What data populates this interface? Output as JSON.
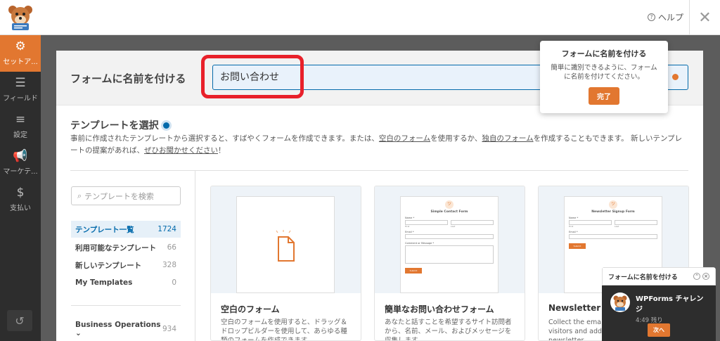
{
  "topbar": {
    "help_label": "ヘルプ",
    "help_icon": "question-circle-icon",
    "close_icon": "close-icon"
  },
  "sidebar": {
    "items": [
      {
        "label": "セットア...",
        "icon": "gear-icon"
      },
      {
        "label": "フィールド",
        "icon": "list-icon"
      },
      {
        "label": "設定",
        "icon": "sliders-icon"
      },
      {
        "label": "マーケテ...",
        "icon": "megaphone-icon"
      },
      {
        "label": "支払い",
        "icon": "dollar-icon"
      }
    ],
    "undo_icon": "history-icon"
  },
  "form_name": {
    "label": "フォームに名前を付ける",
    "value": "お問い合わせ"
  },
  "tooltip": {
    "title": "フォームに名前を付ける",
    "text": "簡単に識別できるように、フォームに名前を付けてください。",
    "button": "完了"
  },
  "templates": {
    "title": "テンプレートを選択",
    "desc_1": "事前に作成されたテンプレートから選択すると、すばやくフォームを作成できます。または、",
    "desc_link1": "空白のフォーム",
    "desc_2": "を使用するか、",
    "desc_link2": "独自のフォーム",
    "desc_3": "を作成することもできます。 新しいテンプレートの提案があれば、",
    "desc_link3": "ぜひお聞かせください",
    "desc_4": "！",
    "search_placeholder": "テンプレートを検索",
    "categories": [
      {
        "label": "テンプレート一覧",
        "count": "1724"
      },
      {
        "label": "利用可能なテンプレート",
        "count": "66"
      },
      {
        "label": "新しいテンプレート",
        "count": "328"
      },
      {
        "label": "My Templates",
        "count": "0"
      },
      {
        "label": "Business Operations",
        "count": "934"
      }
    ],
    "cards": [
      {
        "title": "空白のフォーム",
        "desc": "空白のフォームを使用すると、ドラッグ＆ドロップビルダーを使用して、あらゆる種類のフォームを作成できます。"
      },
      {
        "title": "簡単なお問い合わせフォーム",
        "desc": "あなたと話すことを希望するサイト訪問者から、名前、メール、およびメッセージを収集します。",
        "preview": {
          "title": "Simple Contact Form",
          "name": "Name *",
          "first": "First",
          "last": "Last",
          "email": "Email *",
          "comment": "Comment or Message *",
          "submit": "Submit"
        }
      },
      {
        "title": "Newsletter Signup Form",
        "desc": "Collect the email addresses of website visitors and add them to your newsletter.",
        "preview": {
          "title": "Newsletter Signup Form",
          "name": "Name *",
          "first": "First",
          "last": "Last",
          "email": "Email *",
          "submit": "Submit"
        }
      }
    ]
  },
  "challenge": {
    "header": "フォームに名前を付ける",
    "title": "WPForms チャレンジ",
    "remaining": "4:49 残り",
    "next": "次へ"
  },
  "colors": {
    "accent": "#e27730",
    "link": "#036aab",
    "sidebar": "#2d2d2d",
    "highlight": "#e8202a"
  }
}
